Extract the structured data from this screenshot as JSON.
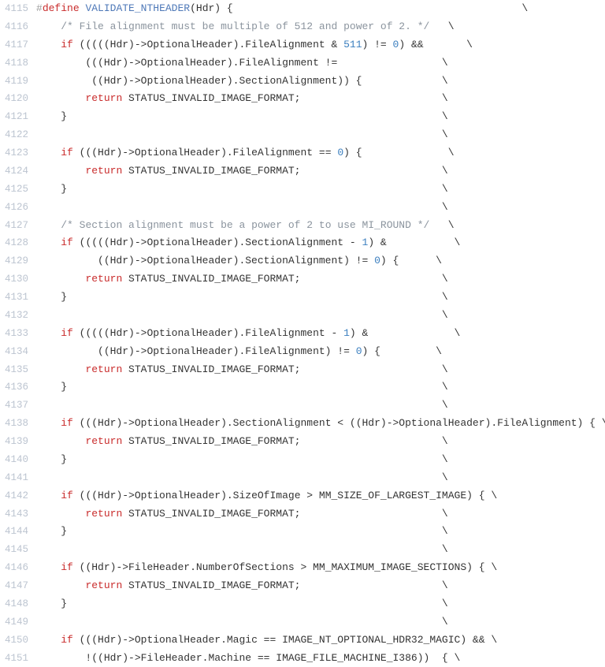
{
  "lines": [
    {
      "n": "4115",
      "segs": [
        {
          "c": "tok-pre",
          "t": "#"
        },
        {
          "c": "tok-define",
          "t": "define"
        },
        {
          "c": "tok-punct",
          "t": " "
        },
        {
          "c": "tok-macro",
          "t": "VALIDATE_NTHEADER"
        },
        {
          "c": "tok-punct",
          "t": "("
        },
        {
          "c": "tok-ident",
          "t": "Hdr"
        },
        {
          "c": "tok-punct",
          "t": ") {                                               \\"
        }
      ]
    },
    {
      "n": "4116",
      "segs": [
        {
          "c": "tok-punct",
          "t": "    "
        },
        {
          "c": "tok-comment",
          "t": "/* File alignment must be multiple of 512 and power of 2. */"
        },
        {
          "c": "tok-punct",
          "t": "   \\"
        }
      ]
    },
    {
      "n": "4117",
      "segs": [
        {
          "c": "tok-punct",
          "t": "    "
        },
        {
          "c": "tok-kw",
          "t": "if"
        },
        {
          "c": "tok-punct",
          "t": " (((((Hdr)->OptionalHeader).FileAlignment & "
        },
        {
          "c": "tok-num",
          "t": "511"
        },
        {
          "c": "tok-punct",
          "t": ") != "
        },
        {
          "c": "tok-num",
          "t": "0"
        },
        {
          "c": "tok-punct",
          "t": ") &&       \\"
        }
      ]
    },
    {
      "n": "4118",
      "segs": [
        {
          "c": "tok-punct",
          "t": "        (((Hdr)->OptionalHeader).FileAlignment !=                 \\"
        }
      ]
    },
    {
      "n": "4119",
      "segs": [
        {
          "c": "tok-punct",
          "t": "         ((Hdr)->OptionalHeader).SectionAlignment)) {             \\"
        }
      ]
    },
    {
      "n": "4120",
      "segs": [
        {
          "c": "tok-punct",
          "t": "        "
        },
        {
          "c": "tok-kw",
          "t": "return"
        },
        {
          "c": "tok-punct",
          "t": " STATUS_INVALID_IMAGE_FORMAT;                       \\"
        }
      ]
    },
    {
      "n": "4121",
      "segs": [
        {
          "c": "tok-punct",
          "t": "    }                                                             \\"
        }
      ]
    },
    {
      "n": "4122",
      "segs": [
        {
          "c": "tok-punct",
          "t": "                                                                  \\"
        }
      ]
    },
    {
      "n": "4123",
      "segs": [
        {
          "c": "tok-punct",
          "t": "    "
        },
        {
          "c": "tok-kw",
          "t": "if"
        },
        {
          "c": "tok-punct",
          "t": " (((Hdr)->OptionalHeader).FileAlignment == "
        },
        {
          "c": "tok-num",
          "t": "0"
        },
        {
          "c": "tok-punct",
          "t": ") {              \\"
        }
      ]
    },
    {
      "n": "4124",
      "segs": [
        {
          "c": "tok-punct",
          "t": "        "
        },
        {
          "c": "tok-kw",
          "t": "return"
        },
        {
          "c": "tok-punct",
          "t": " STATUS_INVALID_IMAGE_FORMAT;                       \\"
        }
      ]
    },
    {
      "n": "4125",
      "segs": [
        {
          "c": "tok-punct",
          "t": "    }                                                             \\"
        }
      ]
    },
    {
      "n": "4126",
      "segs": [
        {
          "c": "tok-punct",
          "t": "                                                                  \\"
        }
      ]
    },
    {
      "n": "4127",
      "segs": [
        {
          "c": "tok-punct",
          "t": "    "
        },
        {
          "c": "tok-comment",
          "t": "/* Section alignment must be a power of 2 to use MI_ROUND */"
        },
        {
          "c": "tok-punct",
          "t": "   \\"
        }
      ]
    },
    {
      "n": "4128",
      "segs": [
        {
          "c": "tok-punct",
          "t": "    "
        },
        {
          "c": "tok-kw",
          "t": "if"
        },
        {
          "c": "tok-punct",
          "t": " (((((Hdr)->OptionalHeader).SectionAlignment - "
        },
        {
          "c": "tok-num",
          "t": "1"
        },
        {
          "c": "tok-punct",
          "t": ") &           \\"
        }
      ]
    },
    {
      "n": "4129",
      "segs": [
        {
          "c": "tok-punct",
          "t": "          ((Hdr)->OptionalHeader).SectionAlignment) != "
        },
        {
          "c": "tok-num",
          "t": "0"
        },
        {
          "c": "tok-punct",
          "t": ") {      \\"
        }
      ]
    },
    {
      "n": "4130",
      "segs": [
        {
          "c": "tok-punct",
          "t": "        "
        },
        {
          "c": "tok-kw",
          "t": "return"
        },
        {
          "c": "tok-punct",
          "t": " STATUS_INVALID_IMAGE_FORMAT;                       \\"
        }
      ]
    },
    {
      "n": "4131",
      "segs": [
        {
          "c": "tok-punct",
          "t": "    }                                                             \\"
        }
      ]
    },
    {
      "n": "4132",
      "segs": [
        {
          "c": "tok-punct",
          "t": "                                                                  \\"
        }
      ]
    },
    {
      "n": "4133",
      "segs": [
        {
          "c": "tok-punct",
          "t": "    "
        },
        {
          "c": "tok-kw",
          "t": "if"
        },
        {
          "c": "tok-punct",
          "t": " (((((Hdr)->OptionalHeader).FileAlignment - "
        },
        {
          "c": "tok-num",
          "t": "1"
        },
        {
          "c": "tok-punct",
          "t": ") &              \\"
        }
      ]
    },
    {
      "n": "4134",
      "segs": [
        {
          "c": "tok-punct",
          "t": "          ((Hdr)->OptionalHeader).FileAlignment) != "
        },
        {
          "c": "tok-num",
          "t": "0"
        },
        {
          "c": "tok-punct",
          "t": ") {         \\"
        }
      ]
    },
    {
      "n": "4135",
      "segs": [
        {
          "c": "tok-punct",
          "t": "        "
        },
        {
          "c": "tok-kw",
          "t": "return"
        },
        {
          "c": "tok-punct",
          "t": " STATUS_INVALID_IMAGE_FORMAT;                       \\"
        }
      ]
    },
    {
      "n": "4136",
      "segs": [
        {
          "c": "tok-punct",
          "t": "    }                                                             \\"
        }
      ]
    },
    {
      "n": "4137",
      "segs": [
        {
          "c": "tok-punct",
          "t": "                                                                  \\"
        }
      ]
    },
    {
      "n": "4138",
      "segs": [
        {
          "c": "tok-punct",
          "t": "    "
        },
        {
          "c": "tok-kw",
          "t": "if"
        },
        {
          "c": "tok-punct",
          "t": " (((Hdr)->OptionalHeader).SectionAlignment < ((Hdr)->OptionalHeader).FileAlignment) { \\"
        }
      ]
    },
    {
      "n": "4139",
      "segs": [
        {
          "c": "tok-punct",
          "t": "        "
        },
        {
          "c": "tok-kw",
          "t": "return"
        },
        {
          "c": "tok-punct",
          "t": " STATUS_INVALID_IMAGE_FORMAT;                       \\"
        }
      ]
    },
    {
      "n": "4140",
      "segs": [
        {
          "c": "tok-punct",
          "t": "    }                                                             \\"
        }
      ]
    },
    {
      "n": "4141",
      "segs": [
        {
          "c": "tok-punct",
          "t": "                                                                  \\"
        }
      ]
    },
    {
      "n": "4142",
      "segs": [
        {
          "c": "tok-punct",
          "t": "    "
        },
        {
          "c": "tok-kw",
          "t": "if"
        },
        {
          "c": "tok-punct",
          "t": " (((Hdr)->OptionalHeader).SizeOfImage > MM_SIZE_OF_LARGEST_IMAGE) { \\"
        }
      ]
    },
    {
      "n": "4143",
      "segs": [
        {
          "c": "tok-punct",
          "t": "        "
        },
        {
          "c": "tok-kw",
          "t": "return"
        },
        {
          "c": "tok-punct",
          "t": " STATUS_INVALID_IMAGE_FORMAT;                       \\"
        }
      ]
    },
    {
      "n": "4144",
      "segs": [
        {
          "c": "tok-punct",
          "t": "    }                                                             \\"
        }
      ]
    },
    {
      "n": "4145",
      "segs": [
        {
          "c": "tok-punct",
          "t": "                                                                  \\"
        }
      ]
    },
    {
      "n": "4146",
      "segs": [
        {
          "c": "tok-punct",
          "t": "    "
        },
        {
          "c": "tok-kw",
          "t": "if"
        },
        {
          "c": "tok-punct",
          "t": " ((Hdr)->FileHeader.NumberOfSections > MM_MAXIMUM_IMAGE_SECTIONS) { \\"
        }
      ]
    },
    {
      "n": "4147",
      "segs": [
        {
          "c": "tok-punct",
          "t": "        "
        },
        {
          "c": "tok-kw",
          "t": "return"
        },
        {
          "c": "tok-punct",
          "t": " STATUS_INVALID_IMAGE_FORMAT;                       \\"
        }
      ]
    },
    {
      "n": "4148",
      "segs": [
        {
          "c": "tok-punct",
          "t": "    }                                                             \\"
        }
      ]
    },
    {
      "n": "4149",
      "segs": [
        {
          "c": "tok-punct",
          "t": "                                                                  \\"
        }
      ]
    },
    {
      "n": "4150",
      "segs": [
        {
          "c": "tok-punct",
          "t": "    "
        },
        {
          "c": "tok-kw",
          "t": "if"
        },
        {
          "c": "tok-punct",
          "t": " (((Hdr)->OptionalHeader.Magic == IMAGE_NT_OPTIONAL_HDR32_MAGIC) && \\"
        }
      ]
    },
    {
      "n": "4151",
      "segs": [
        {
          "c": "tok-punct",
          "t": "        !((Hdr)->FileHeader.Machine == IMAGE_FILE_MACHINE_I386))  { \\"
        }
      ]
    }
  ]
}
